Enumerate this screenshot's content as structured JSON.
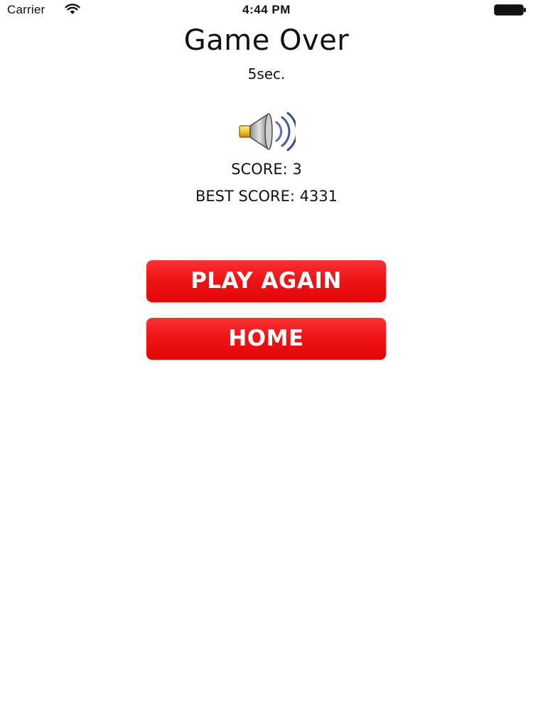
{
  "status_bar": {
    "carrier": "Carrier",
    "time": "4:44 PM",
    "wifi_icon": "wifi-icon",
    "battery_icon": "battery-full-icon"
  },
  "game_over": {
    "title": "Game Over",
    "elapsed": "5sec.",
    "sound_icon": "speaker-volume-icon",
    "score": "SCORE: 3",
    "best_score": "BEST SCORE: 4331"
  },
  "buttons": {
    "play_again": "PLAY AGAIN",
    "home": "HOME"
  },
  "colors": {
    "button_red": "#ee1517",
    "button_text": "#ffffff",
    "background": "#ffffff"
  }
}
